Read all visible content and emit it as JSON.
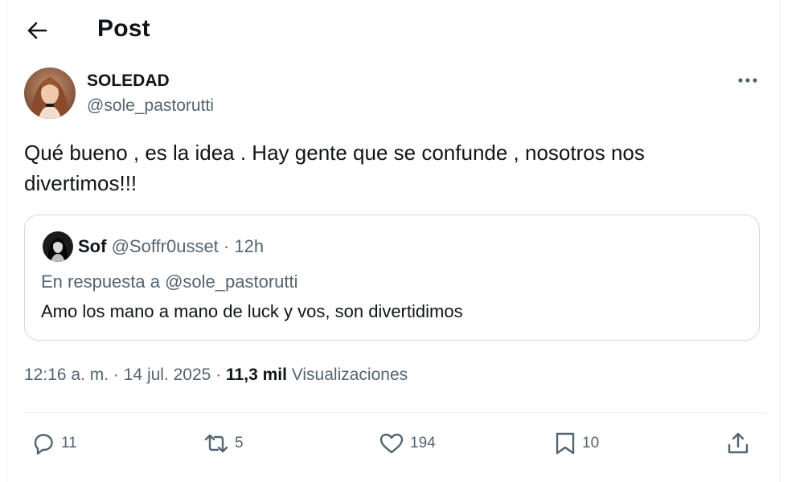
{
  "header": {
    "title": "Post",
    "back_icon": "arrow-left-icon"
  },
  "post": {
    "author": {
      "name": "SOLEDAD",
      "handle": "@sole_pastorutti"
    },
    "text": "Qué bueno , es la idea . Hay gente que se confunde , nosotros nos divertimos!!!",
    "more_icon": "more-horizontal-icon"
  },
  "quote": {
    "author": {
      "name": "Sof",
      "handle": "@Soffr0usset",
      "separator": "·",
      "time": "12h"
    },
    "reply_to": "En respuesta a @sole_pastorutti",
    "text": "Amo los mano a mano de luck y vos, son divertidimos"
  },
  "meta": {
    "time": "12:16 a. m.",
    "sep1": "·",
    "date": "14 jul. 2025",
    "sep2": "·",
    "views_count": "11,3 mil",
    "views_label": "Visualizaciones"
  },
  "actions": {
    "replies": "11",
    "reposts": "5",
    "likes": "194",
    "bookmarks": "10"
  },
  "colors": {
    "text": "#0f1419",
    "secondary": "#536471",
    "border": "#cfd9de"
  }
}
